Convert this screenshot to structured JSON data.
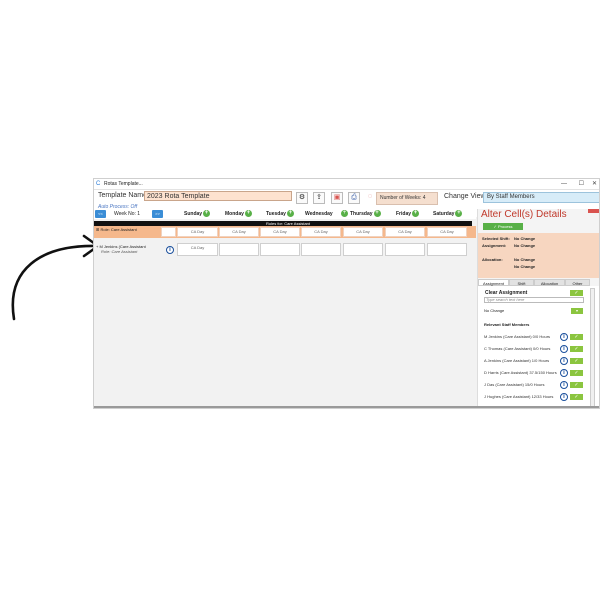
{
  "window": {
    "title": "Rotas Template...",
    "controls": [
      "—",
      "☐",
      "✕"
    ]
  },
  "header": {
    "template_name_label": "Template Name:",
    "template_name_value": "2023 Rota Template",
    "auto_process": "Auto Process: Off",
    "number_of_weeks": "Number of Weeks: 4",
    "change_view_label": "Change View:",
    "change_view_value": "By Staff Members"
  },
  "grid": {
    "nav_prev": "<<",
    "nav_next": ">>",
    "week_no": "Week No: 1",
    "days": [
      "Sunday",
      "Monday",
      "Tuesday",
      "Wednesday",
      "Thursday",
      "Friday",
      "Saturday"
    ],
    "role_header": "Roles for: Care Assistant",
    "role_row_label": "Role: Care Assistant",
    "role_cells": [
      "",
      "CA Day",
      "CA Day",
      "CA Day",
      "CA Day",
      "CA Day",
      "CA Day",
      "CA Day"
    ],
    "staff_name": "M Jenkins (Care Assistant",
    "staff_role": "Role: Care Assistant",
    "staff_cell_first": "CA Day"
  },
  "panel": {
    "title": "Alter Cell(s) Details",
    "process_button": "Process",
    "selected_shift_label": "Selected Shift:",
    "selected_shift_value": "No Change",
    "assignment_label": "Assignment:",
    "assignment_value": "No Change",
    "allocation_label": "Allocation:",
    "allocation_value1": "No Change",
    "allocation_value2": "No Change",
    "tabs": [
      "Assignment",
      "Shift",
      "Allocation",
      "Other"
    ],
    "clear_assignment": "Clear Assignment",
    "search_placeholder": "Type search text here",
    "no_change": "No Change",
    "relevant_title": "Relevant Staff Members",
    "staff": [
      "M Jenkins (Care Assistant) 0/0 Hours",
      "C Thomas (Care Assistant) 0/0 Hours",
      "A Jenkins (Care Assistant) 1/0 Hours",
      "D Harris (Care Assistant) 37.5/150 Hours",
      "J Das (Care Assistant) 15/0 Hours",
      "J Hughes (Care Assistant) 12/33 Hours"
    ]
  },
  "colors": {
    "accent_blue": "#3a8dd6",
    "role_orange": "#f5b88c",
    "green": "#58b047",
    "title_red": "#c0392b"
  }
}
